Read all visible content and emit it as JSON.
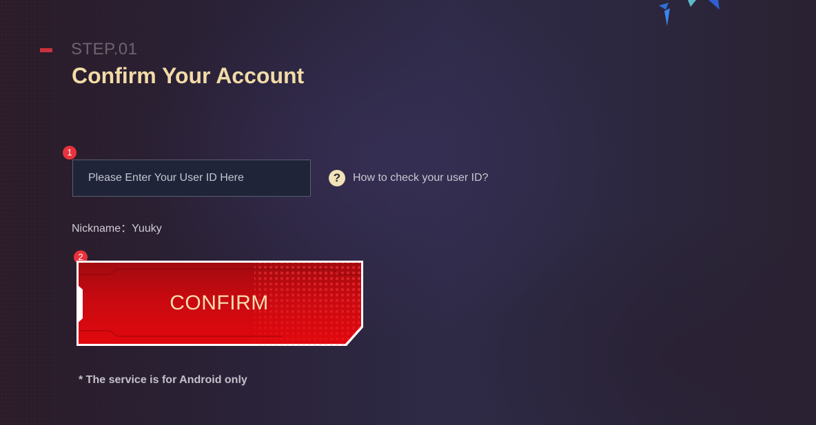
{
  "step": {
    "label": "STEP.01",
    "title": "Confirm Your Account"
  },
  "form": {
    "badge_1": "1",
    "badge_2": "2",
    "userid_placeholder": "Please Enter Your User ID Here",
    "userid_value": "",
    "help_icon": "question-mark-icon",
    "help_glyph": "?",
    "help_text": "How to check your user ID?",
    "nickname_label": "Nickname：",
    "nickname_value": "Yuuky",
    "confirm_label": "CONFIRM",
    "note": "* The service is for Android only"
  },
  "colors": {
    "title": "#f2dba7",
    "step_accent": "#c8323e",
    "badge": "#e8323c",
    "button_red": "#d40a10",
    "button_text": "#f4deb2"
  }
}
